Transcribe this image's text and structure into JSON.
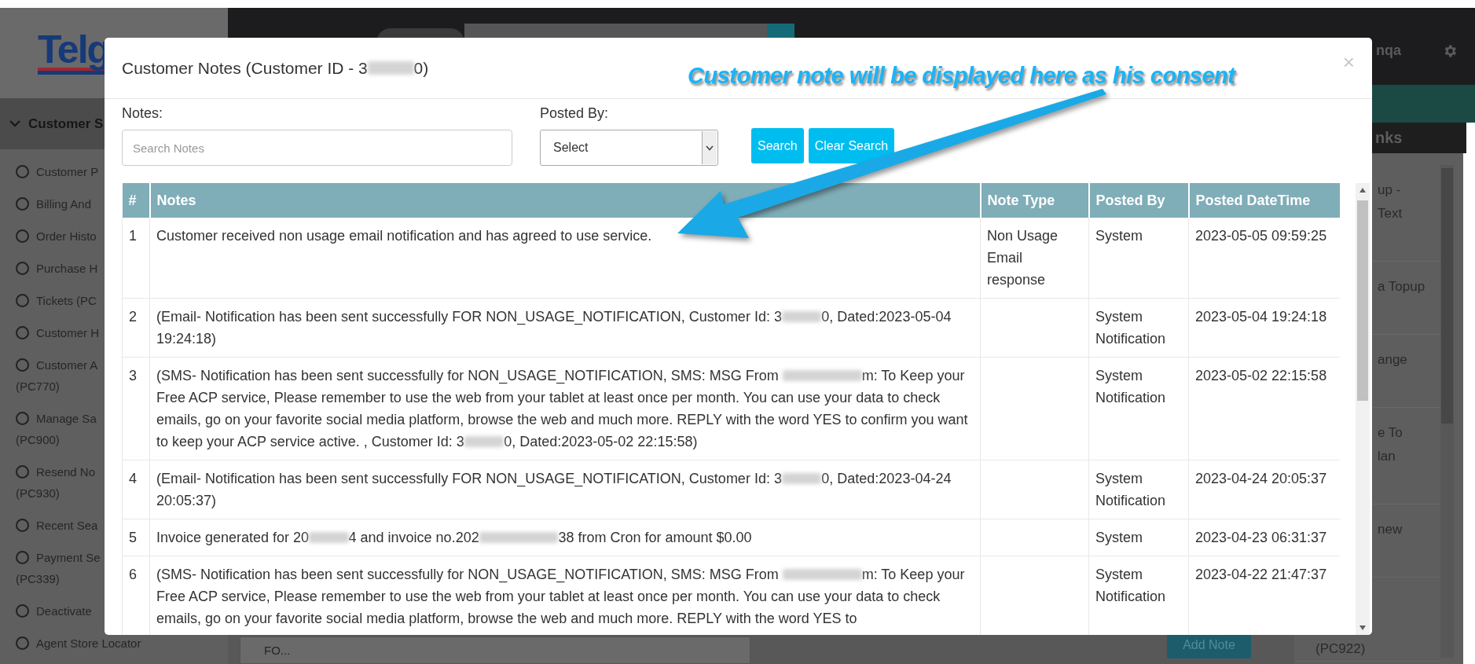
{
  "sidebar": {
    "logo": "Telg",
    "section": "Customer S",
    "items": [
      {
        "lines": [
          "Customer P"
        ]
      },
      {
        "lines": [
          "Billing And"
        ]
      },
      {
        "lines": [
          "Order Histo"
        ]
      },
      {
        "lines": [
          "Purchase H"
        ]
      },
      {
        "lines": [
          "Tickets (PC"
        ]
      },
      {
        "lines": [
          "Customer H"
        ]
      },
      {
        "lines": [
          "Customer A",
          "(PC770)"
        ]
      },
      {
        "lines": [
          "Manage Sa",
          "(PC900)"
        ]
      },
      {
        "lines": [
          "Resend No",
          "(PC930)"
        ]
      },
      {
        "lines": [
          "Recent Sea"
        ]
      },
      {
        "lines": [
          "Payment Se",
          "(PC339)"
        ]
      },
      {
        "lines": [
          "Deactivate"
        ]
      },
      {
        "lines": [
          "Agent Store Locator"
        ]
      }
    ]
  },
  "header": {
    "user": "nqa"
  },
  "right_panel": {
    "title": "nks",
    "items": [
      {
        "kind": "fragment",
        "lines": [
          "up -",
          "Text"
        ]
      },
      {
        "kind": "fragment",
        "lines": [
          "a Topup"
        ]
      },
      {
        "kind": "fragment",
        "lines": [
          "ange"
        ]
      },
      {
        "kind": "fragment",
        "lines": [
          "e To",
          "lan"
        ]
      },
      {
        "kind": "fragment",
        "lines": [
          "new"
        ]
      },
      {
        "kind": "continuation",
        "lines": [
          "(PC922)"
        ]
      }
    ]
  },
  "content": {
    "select": {
      "value": "FO..."
    },
    "button": "Add Note"
  },
  "modal": {
    "title": [
      "Customer Notes (Customer ID - 3",
      {
        "kind": "redacted"
      },
      "0)"
    ],
    "close": "×",
    "notes_filter": {
      "label": "Notes:",
      "placeholder": "Search Notes"
    },
    "posted_by_filter": {
      "label": "Posted By:",
      "value": "Select"
    },
    "buttons": [
      "Search",
      "Clear Search"
    ],
    "table": {
      "columns": [
        "#",
        "Notes",
        "Note Type",
        "Posted By",
        "Posted DateTime"
      ],
      "rows": [
        {
          "num": "1",
          "note": [
            "Customer received non usage email notification and has agreed to use service."
          ],
          "note_type": "Non Usage Email response",
          "posted_by": "System",
          "datetime": "2023-05-05 09:59:25"
        },
        {
          "num": "2",
          "note": [
            "(Email- Notification has been sent successfully FOR NON_USAGE_NOTIFICATION, Customer Id: 3",
            {
              "kind": "redacted"
            },
            "0, Dated:2023-05-04 19:24:18)"
          ],
          "posted_by": "System Notification",
          "datetime": "2023-05-04 19:24:18"
        },
        {
          "num": "3",
          "note": [
            "(SMS- Notification has been sent successfully for NON_USAGE_NOTIFICATION, SMS: MSG From ",
            {
              "kind": "redacted_long"
            },
            "m: To Keep your Free ACP service, Please remember to use the web from your tablet at least once per month. You can use your data to check emails, go on your favorite social media platform, browse the web and much more. REPLY with the word YES to confirm you want to keep your ACP service active. , Customer Id: 3",
            {
              "kind": "redacted"
            },
            "0, Dated:2023-05-02 22:15:58)"
          ],
          "posted_by": "System Notification",
          "datetime": "2023-05-02 22:15:58"
        },
        {
          "num": "4",
          "note": [
            "(Email- Notification has been sent successfully FOR NON_USAGE_NOTIFICATION, Customer Id: 3",
            {
              "kind": "redacted"
            },
            "0, Dated:2023-04-24 20:05:37)"
          ],
          "posted_by": "System Notification",
          "datetime": "2023-04-24 20:05:37"
        },
        {
          "num": "5",
          "note": [
            "Invoice generated for 20",
            {
              "kind": "redacted"
            },
            "4 and invoice no.202",
            {
              "kind": "redacted_long"
            },
            "38 from Cron for amount $0.00"
          ],
          "posted_by": "System",
          "datetime": "2023-04-23 06:31:37"
        },
        {
          "num": "6",
          "note": [
            "(SMS- Notification has been sent successfully for NON_USAGE_NOTIFICATION, SMS: MSG From ",
            {
              "kind": "redacted_long"
            },
            "m: To Keep your Free ACP service, Please remember to use the web from your tablet at least once per month. You can use your data to check emails, go on your favorite social media platform, browse the web and much more. REPLY with the word YES to"
          ],
          "posted_by": "System Notification",
          "datetime": "2023-04-22 21:47:37"
        }
      ]
    }
  },
  "annotation": {
    "text": "Customer note will be displayed here as his consent"
  }
}
